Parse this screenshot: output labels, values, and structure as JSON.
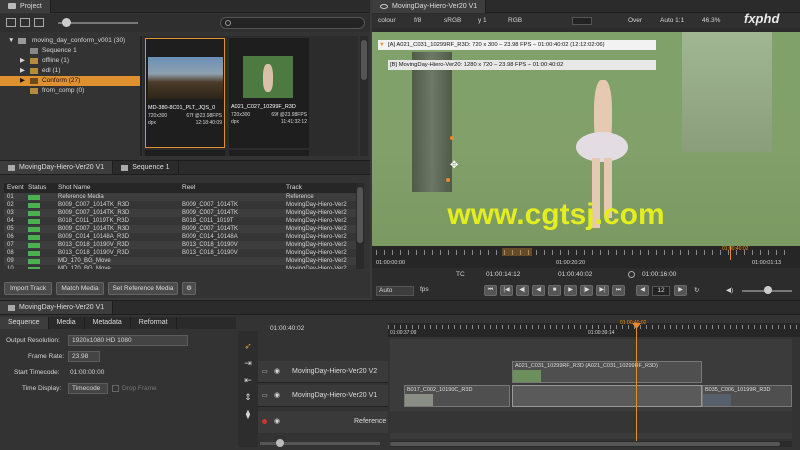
{
  "project": {
    "title": "Project",
    "tree": [
      {
        "label": "moving_day_conform_v001 (30)"
      },
      {
        "label": "Sequence 1"
      },
      {
        "label": "offline (1)"
      },
      {
        "label": "edl (1)"
      },
      {
        "label": "Conform (27)"
      },
      {
        "label": "from_comp (0)"
      }
    ],
    "thumbs": [
      {
        "name": "MD-380-8C01_PLT_JQS_0",
        "res": "720x300",
        "fps": "67f @23.98FPS",
        "tc": "12:18:40:09",
        "fmt": "dpx"
      },
      {
        "name": "A021_C027_10299F_R3D",
        "res": "720x300",
        "fps": "69f @23.98FPS",
        "tc": "11:41:32:12",
        "fmt": "dpx"
      }
    ]
  },
  "sequence_tabs": [
    "MovingDay-Hiero-Ver20 V1",
    "Sequence 1"
  ],
  "events": {
    "headers": [
      "Event",
      "Status",
      "Shot Name",
      "Reel",
      "Track"
    ],
    "rows": [
      [
        "01",
        "",
        "Reference Media",
        "",
        "Reference"
      ],
      [
        "02",
        "",
        "B009_C007_1014TK_R3D",
        "B009_C007_1014TK",
        "MovingDay-Hiero-Ver2"
      ],
      [
        "03",
        "",
        "B009_C007_1014TK_R3D",
        "B009_C007_1014TK",
        "MovingDay-Hiero-Ver2"
      ],
      [
        "04",
        "",
        "B018_C011_1019TK_R3D",
        "B018_C011_1019T",
        "MovingDay-Hiero-Ver2"
      ],
      [
        "05",
        "",
        "B009_C007_1014TK_R3D",
        "B009_C007_1014TK",
        "MovingDay-Hiero-Ver2"
      ],
      [
        "06",
        "",
        "B009_C014_10148A_R3D",
        "B009_C014_10148A",
        "MovingDay-Hiero-Ver2"
      ],
      [
        "07",
        "",
        "B013_C018_10190V_R3D",
        "B013_C018_10190V",
        "MovingDay-Hiero-Ver2"
      ],
      [
        "08",
        "",
        "B013_C018_10190V_R3D",
        "B013_C018_10190V",
        "MovingDay-Hiero-Ver2"
      ],
      [
        "09",
        "",
        "MD_170_BG_Move",
        "",
        "MovingDay-Hiero-Ver2"
      ],
      [
        "10",
        "",
        "MD_170_BG_Move",
        "",
        "MovingDay-Hiero-Ver2"
      ]
    ],
    "buttons": {
      "import": "Import Track",
      "match": "Match Media",
      "setref": "Set Reference Media"
    }
  },
  "viewer": {
    "tab": "MovingDay-Hiero-Ver20 V1",
    "toolbar": {
      "colour": "colour",
      "fstop": "f/8",
      "lut": "sRGB",
      "gamma": "y 1",
      "channels": "RGB",
      "over": "Over",
      "zoom": "Auto 1:1",
      "percent": "46.3%"
    },
    "info_a": "[A] A021_C031_10299RF_R3D: 720 x 300 – 23.98 FPS – 01:00:40:02 (12:12:02:06)",
    "info_b": "[B] MovingDay-Hiero-Ver20: 1280 x 720 – 23.98 FPS – 01:00:40:02",
    "ruler": {
      "start": "01:00:00:00",
      "mid": "01:00:20:20",
      "end": "01:00:01:13",
      "marker": "01:00:40:02"
    },
    "transport": {
      "tc_label": "TC",
      "in_tc": "01:00:14:12",
      "cur_tc": "01:00:40:02",
      "out_tc": "01:00:16:00",
      "frames": "12",
      "mode": "Auto",
      "fps_label": "fps"
    }
  },
  "timeline": {
    "tab": "MovingDay-Hiero-Ver20 V1",
    "sub_tabs": [
      "Sequence",
      "Media",
      "Metadata",
      "Reformat"
    ],
    "output_label": "Output Resolution:",
    "output_value": "1920x1080 HD 1080",
    "framerate_label": "Frame Rate:",
    "framerate_value": "23.98",
    "start_label": "Start Timecode:",
    "start_value": "01:00:00:00",
    "display_label": "Time Display:",
    "display_value": "Timecode",
    "dropframe_label": "Drop Frame",
    "current_tc": "01:00:40:02",
    "ruler": [
      "01:00:37:09",
      "01:00:39:14",
      "01:00:40:02"
    ],
    "tracks": [
      "MovingDay-Hiero-Ver20 V2",
      "MovingDay-Hiero-Ver20 V1",
      "Reference"
    ],
    "clips_v2": [
      "A021_C031_10299RF_R3D (A021_C031_10299RF_R3D)"
    ],
    "clips_v1": [
      "B017_C002_10190C_R3D",
      "B035_C006_10199R_R3D"
    ]
  },
  "watermark": "www.cgtsj.com",
  "logo": "fxphd",
  "colors": {
    "accent": "#e0912f",
    "playhead": "#e88b2a",
    "green": "#7d9e57"
  }
}
